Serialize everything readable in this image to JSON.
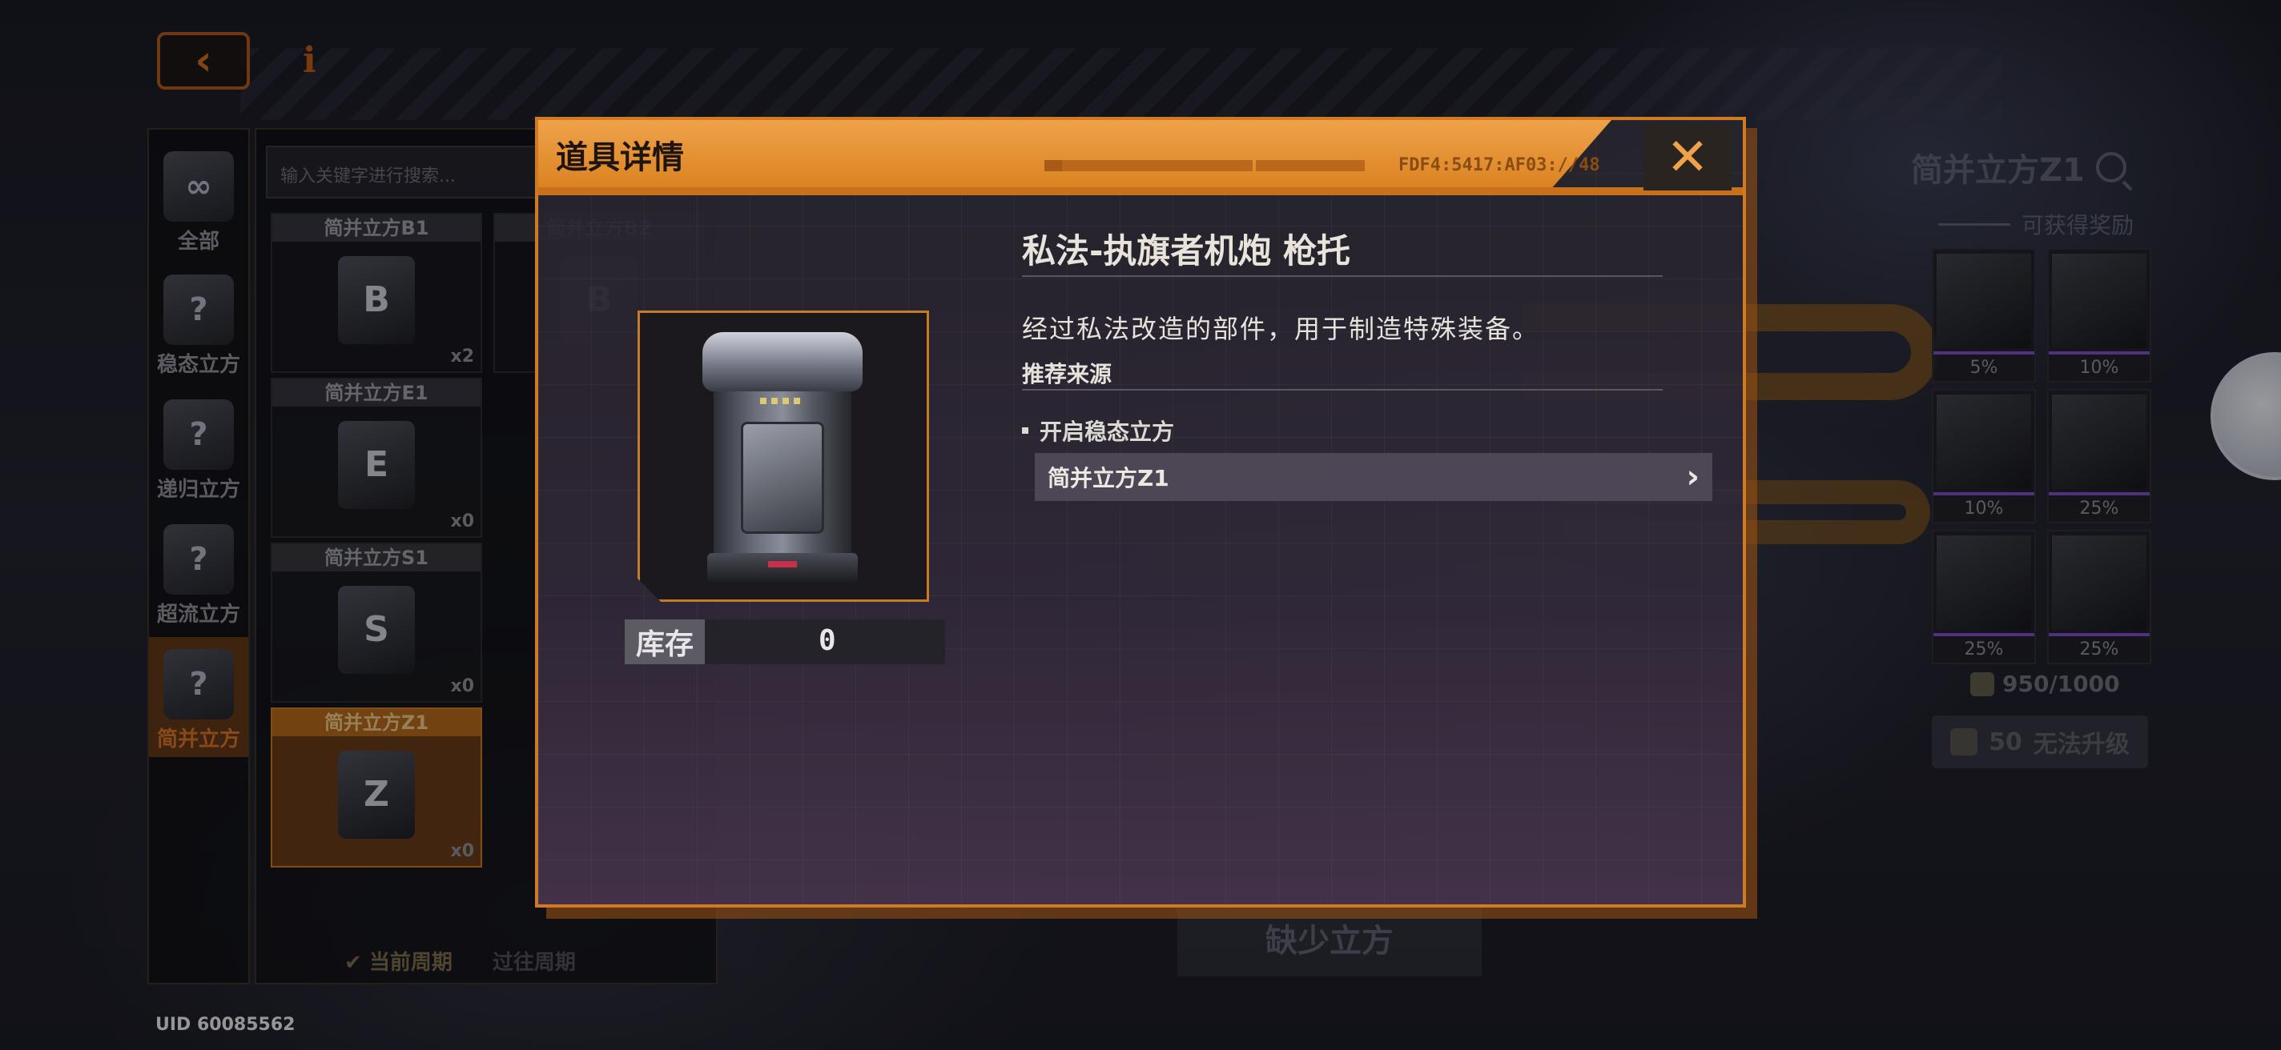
{
  "top_bar": {
    "back_icon": "‹",
    "info_icon": "i"
  },
  "categories": [
    {
      "label": "全部",
      "icon": "∞"
    },
    {
      "label": "稳态立方",
      "icon": "?"
    },
    {
      "label": "递归立方",
      "icon": "?"
    },
    {
      "label": "超流立方",
      "icon": "?"
    },
    {
      "label": "简并立方",
      "icon": "?"
    }
  ],
  "grid": {
    "search_placeholder": "输入关键字进行搜索...",
    "items": [
      {
        "title": "简并立方B1",
        "glyph": "B",
        "count": "x2"
      },
      {
        "title": "简并立方B2",
        "glyph": "B",
        "count": ""
      },
      {
        "title": "简并立方E1",
        "glyph": "E",
        "count": "x0"
      },
      {
        "title": "简并立方S1",
        "glyph": "S",
        "count": "x0"
      },
      {
        "title": "简并立方Z1",
        "glyph": "Z",
        "count": "x0"
      }
    ],
    "period_current": "✔ 当前周期",
    "period_past": "过往周期"
  },
  "uid": "UID 60085562",
  "reward_panel": {
    "title": "简并立方Z1",
    "subtitle": "可获得奖励",
    "cells": [
      {
        "pct": "5%"
      },
      {
        "pct": "10%"
      },
      {
        "pct": "10%"
      },
      {
        "pct": "25%"
      },
      {
        "pct": "25%"
      },
      {
        "pct": "25%"
      }
    ],
    "progress": "950/1000",
    "upgrade_cost": "50",
    "upgrade_label": "无法升级"
  },
  "bottom_button": "缺少立方",
  "modal": {
    "title": "道具详情",
    "header_code": "FDF4:5417:AF03://48",
    "close_icon": "✕",
    "item_name": "私法-执旗者机炮 枪托",
    "description": "经过私法改造的部件，用于制造特殊装备。",
    "source_title": "推荐来源",
    "source_bullet": "开启稳态立方",
    "source_link": "简并立方Z1",
    "source_link_chevron": "›",
    "stock_label": "库存",
    "stock_value": "0"
  }
}
